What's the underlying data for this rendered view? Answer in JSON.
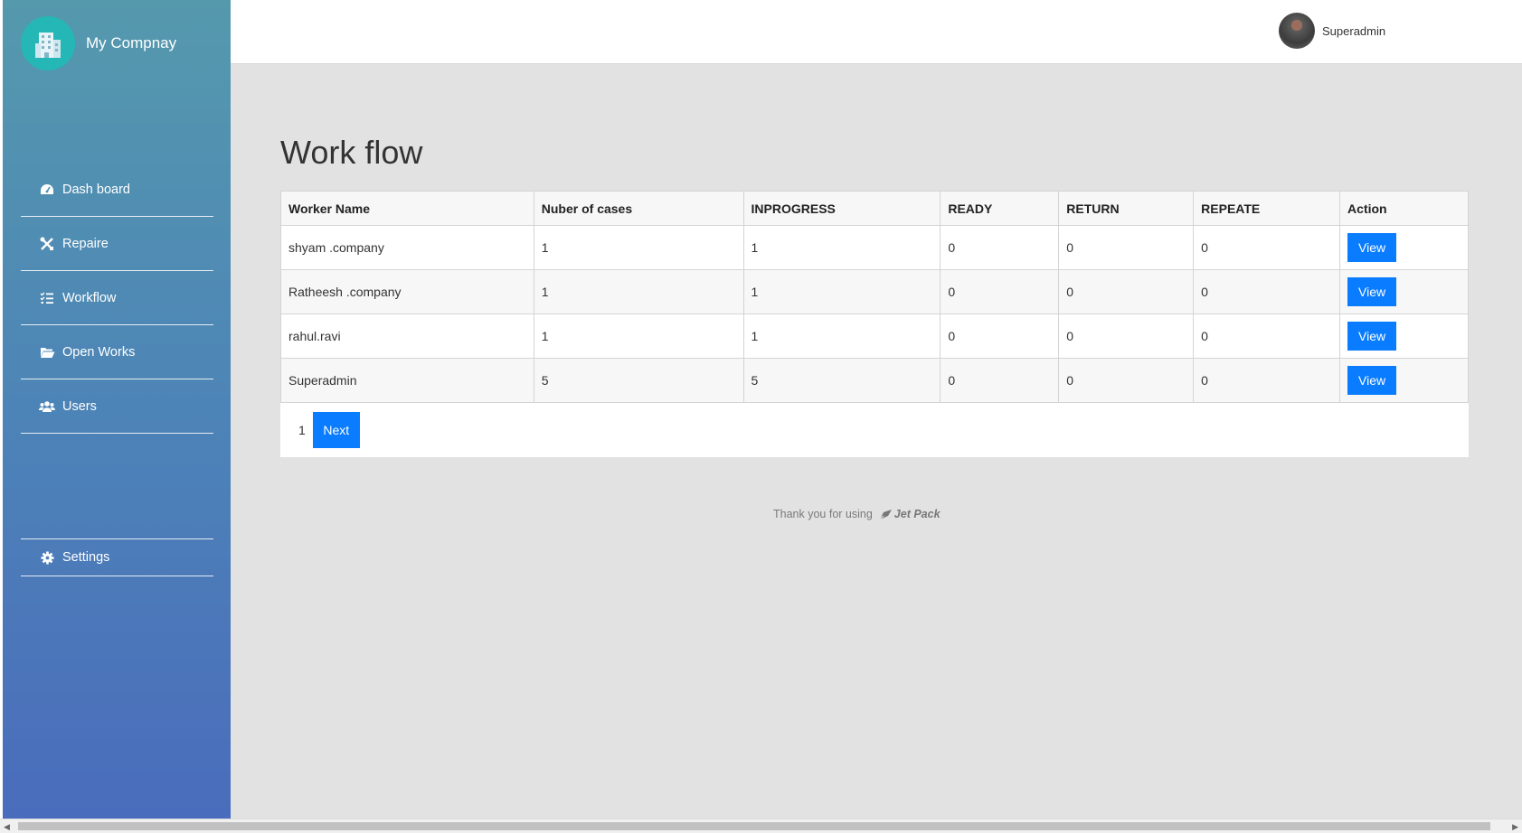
{
  "brand": {
    "name": "My Compnay",
    "icon": "building-icon",
    "accent": "#24b7b5"
  },
  "sidebar": {
    "items": [
      {
        "label": "Dash board",
        "icon": "dashboard-icon"
      },
      {
        "label": "Repaire",
        "icon": "tools-icon"
      },
      {
        "label": "Workflow",
        "icon": "tasks-icon"
      },
      {
        "label": "Open Works",
        "icon": "folder-open-icon"
      },
      {
        "label": "Users",
        "icon": "users-icon"
      }
    ],
    "settings": {
      "label": "Settings",
      "icon": "gear-icon"
    }
  },
  "topbar": {
    "user_name": "Superadmin"
  },
  "main": {
    "title": "Work flow",
    "table": {
      "headers": [
        "Worker Name",
        "Nuber of cases",
        "INPROGRESS",
        "READY",
        "RETURN",
        "REPEATE",
        "Action"
      ],
      "rows": [
        {
          "name": "shyam .company",
          "cases": "1",
          "inprogress": "1",
          "ready": "0",
          "return": "0",
          "repeate": "0",
          "action": "View"
        },
        {
          "name": "Ratheesh .company",
          "cases": "1",
          "inprogress": "1",
          "ready": "0",
          "return": "0",
          "repeate": "0",
          "action": "View"
        },
        {
          "name": "rahul.ravi",
          "cases": "1",
          "inprogress": "1",
          "ready": "0",
          "return": "0",
          "repeate": "0",
          "action": "View"
        },
        {
          "name": "Superadmin",
          "cases": "5",
          "inprogress": "5",
          "ready": "0",
          "return": "0",
          "repeate": "0",
          "action": "View"
        }
      ]
    },
    "pagination": {
      "current_page": "1",
      "next_label": "Next"
    }
  },
  "footer": {
    "text": "Thank you for using",
    "brand": "Jet Pack"
  },
  "colors": {
    "primary_button": "#0a7cff",
    "sidebar_top": "#5599ad",
    "sidebar_bottom": "#4a6cbc"
  }
}
